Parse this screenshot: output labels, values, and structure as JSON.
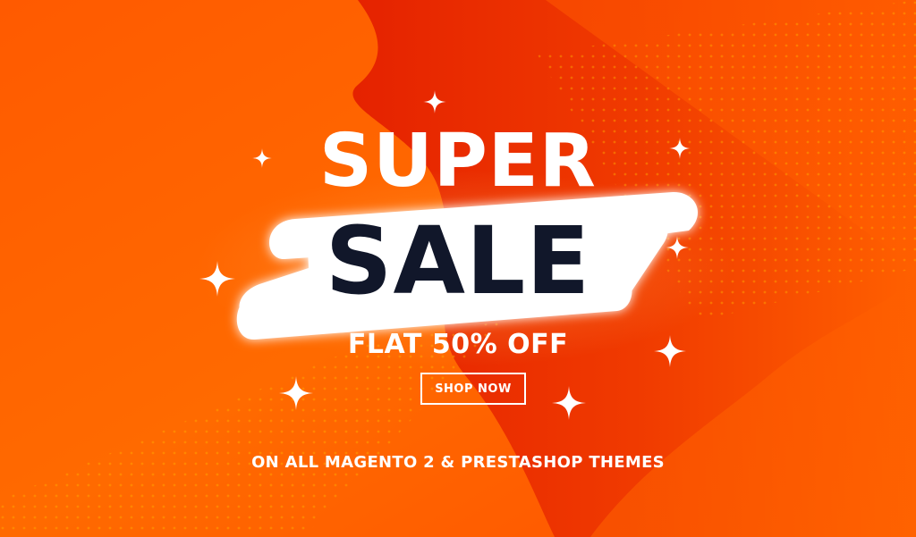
{
  "banner": {
    "headline_top": "SUPER",
    "headline_main": "SALE",
    "offer": "FLAT 50% OFF",
    "cta_label": "SHOP NOW",
    "tagline": "ON ALL MAGENTO 2 & PRESTASHOP THEMES"
  },
  "colors": {
    "background": "#ff6a00",
    "wave": "#e62a00",
    "pill": "#ffffff",
    "sale_text": "#11172a",
    "text": "#ffffff"
  },
  "icons": {
    "sparkle": "sparkle-icon"
  }
}
